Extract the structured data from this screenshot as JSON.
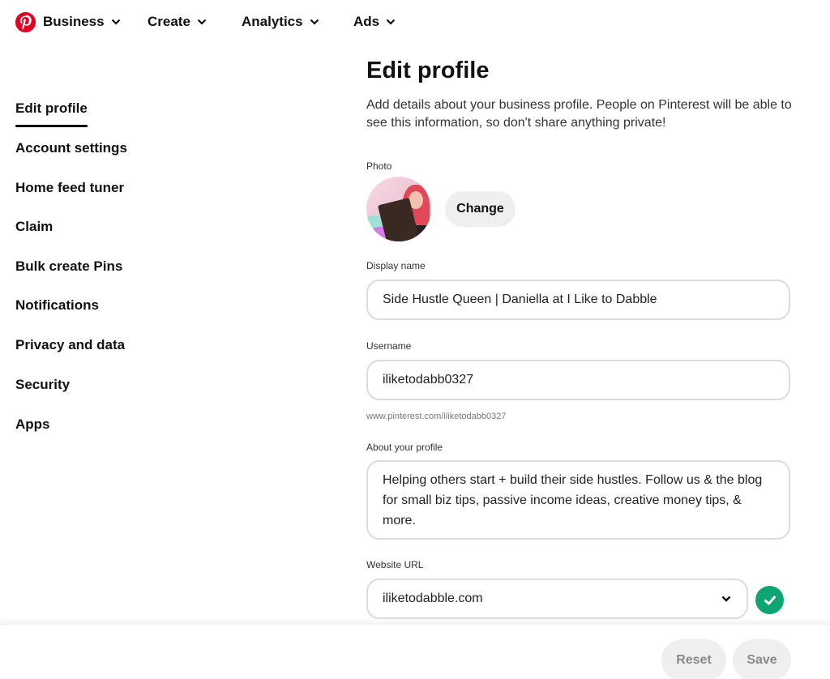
{
  "topnav": {
    "logo": "pinterest-logo",
    "items": [
      {
        "label": "Business",
        "icon": "chevron-down-icon"
      },
      {
        "label": "Create",
        "icon": "chevron-down-icon"
      },
      {
        "label": "Analytics",
        "icon": "chevron-down-icon"
      },
      {
        "label": "Ads",
        "icon": "chevron-down-icon"
      }
    ]
  },
  "sidebar": {
    "active_index": 0,
    "items": [
      {
        "label": "Edit profile"
      },
      {
        "label": "Account settings"
      },
      {
        "label": "Home feed tuner"
      },
      {
        "label": "Claim"
      },
      {
        "label": "Bulk create Pins"
      },
      {
        "label": "Notifications"
      },
      {
        "label": "Privacy and data"
      },
      {
        "label": "Security"
      },
      {
        "label": "Apps"
      }
    ]
  },
  "main": {
    "title": "Edit profile",
    "description": "Add details about your business profile. People on Pinterest will be able to see this information, so don't share anything private!",
    "photo": {
      "label": "Photo",
      "change_label": "Change"
    },
    "display_name": {
      "label": "Display name",
      "value": "Side Hustle Queen | Daniella at I Like to Dabble"
    },
    "username": {
      "label": "Username",
      "value": "iliketodabb0327",
      "helper": "www.pinterest.com/iliketodabb0327"
    },
    "about": {
      "label": "About your profile",
      "value": "Helping others start + build their side hustles. Follow us & the blog for small biz tips, passive income ideas, creative money tips, & more."
    },
    "website": {
      "label": "Website URL",
      "value": "iliketodabble.com",
      "verified_icon": "check-circle-icon",
      "verified_color": "#0fa573"
    }
  },
  "footer": {
    "reset_label": "Reset",
    "save_label": "Save"
  },
  "colors": {
    "brand": "#e60023",
    "success": "#0fa573",
    "button_gray": "#efefef"
  }
}
